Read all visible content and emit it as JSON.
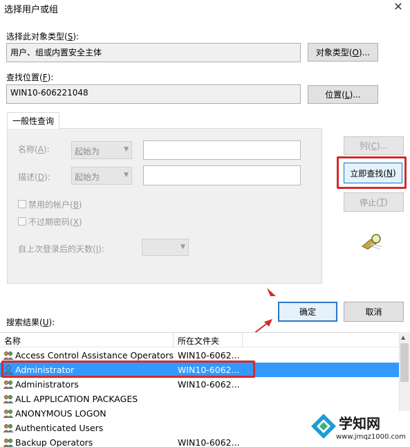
{
  "dialog": {
    "title": "选择用户或组"
  },
  "object_type": {
    "label_prefix": "选择此对象类型(",
    "label_key": "S",
    "label_suffix": "):",
    "value": "用户、组或内置安全主体",
    "button_prefix": "对象类型(",
    "button_key": "O",
    "button_suffix": ")..."
  },
  "location": {
    "label_prefix": "查找位置(",
    "label_key": "F",
    "label_suffix": "):",
    "value": "WIN10-606221048",
    "button_prefix": "位置(",
    "button_key": "L",
    "button_suffix": ")..."
  },
  "query": {
    "tab_label": "一般性查询",
    "name_prefix": "名称(",
    "name_key": "A",
    "name_suffix": "):",
    "name_mode": "起始为",
    "desc_prefix": "描述(",
    "desc_key": "D",
    "desc_suffix": "):",
    "desc_mode": "起始为",
    "disabled_prefix": "禁用的帐户(",
    "disabled_key": "B",
    "disabled_suffix": ")",
    "noexpire_prefix": "不过期密码(",
    "noexpire_key": "X",
    "noexpire_suffix": ")",
    "days_prefix": "自上次登录后的天数(",
    "days_key": "I",
    "days_suffix": "):"
  },
  "side_buttons": {
    "columns_prefix": "列(",
    "columns_key": "C",
    "columns_suffix": ")...",
    "find_prefix": "立即查找(",
    "find_key": "N",
    "find_suffix": ")",
    "stop_prefix": "停止(",
    "stop_key": "T",
    "stop_suffix": ")"
  },
  "actions": {
    "ok": "确定",
    "cancel": "取消"
  },
  "results": {
    "label_prefix": "搜索结果(",
    "label_key": "U",
    "label_suffix": "):",
    "col_name": "名称",
    "col_folder": "所在文件夹",
    "rows": [
      {
        "name": "Access Control Assistance Operators",
        "folder": "WIN10-6062..."
      },
      {
        "name": "Administrator",
        "folder": "WIN10-6062..."
      },
      {
        "name": "Administrators",
        "folder": "WIN10-6062..."
      },
      {
        "name": "ALL APPLICATION PACKAGES",
        "folder": ""
      },
      {
        "name": "ANONYMOUS LOGON",
        "folder": ""
      },
      {
        "name": "Authenticated Users",
        "folder": ""
      },
      {
        "name": "Backup Operators",
        "folder": "WIN10-6062..."
      }
    ]
  },
  "watermark": {
    "brand": "学知网",
    "url": "www.jmqz1000.com"
  },
  "colors": {
    "highlight_red": "#d42a2a",
    "selection_blue": "#3399ff",
    "default_button_border": "#2a78c8"
  }
}
